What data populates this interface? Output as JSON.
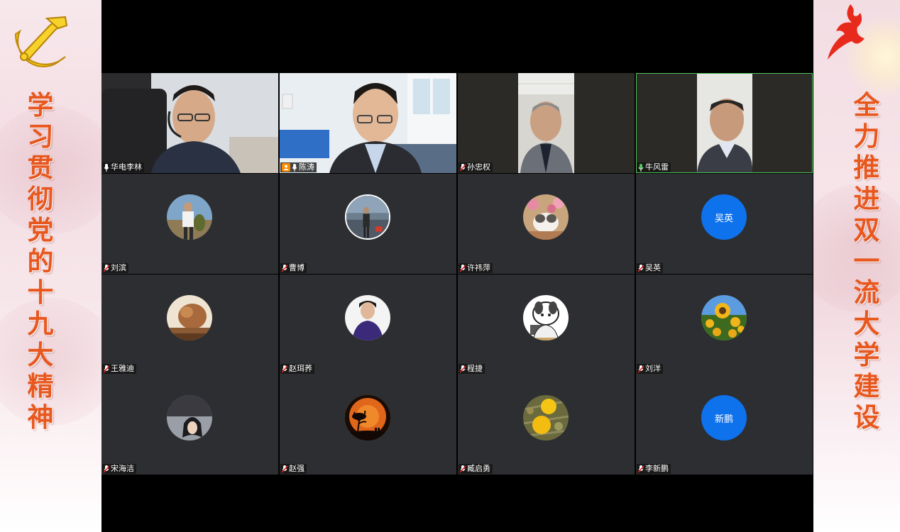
{
  "banners": {
    "left_slogan": [
      "学",
      "习",
      "贯",
      "彻",
      "党",
      "的",
      "十",
      "九",
      "大",
      "精",
      "神"
    ],
    "right_slogan": [
      "全",
      "力",
      "推",
      "进",
      "双",
      "一",
      "流",
      "大",
      "学",
      "建",
      "设"
    ],
    "left_emblem_icon": "hammer-sickle-icon",
    "right_emblem_icon": "red-eagle-icon"
  },
  "meeting": {
    "active_speaker_color": "#4fc45a",
    "avatar_color": "#0e72ed",
    "participants": [
      {
        "name": "华电李林",
        "mic": "on",
        "video": true
      },
      {
        "name": "陈涛",
        "mic": "on",
        "video": true,
        "host": true
      },
      {
        "name": "孙忠权",
        "mic": "muted",
        "video": true
      },
      {
        "name": "牛风雷",
        "mic": "speaking",
        "video": true,
        "active": true
      },
      {
        "name": "刘滨",
        "mic": "muted",
        "avatar": "photo-man-fishing"
      },
      {
        "name": "曹博",
        "mic": "muted",
        "avatar": "photo-man-lake"
      },
      {
        "name": "许祎萍",
        "mic": "muted",
        "avatar": "photo-cat"
      },
      {
        "name": "吴英",
        "mic": "muted",
        "avatar_text": "吴英"
      },
      {
        "name": "王雅迪",
        "mic": "muted",
        "avatar": "photo-bear-toy"
      },
      {
        "name": "赵珥荞",
        "mic": "muted",
        "avatar": "photo-man-purple"
      },
      {
        "name": "程捷",
        "mic": "muted",
        "avatar": "cartoon-dog"
      },
      {
        "name": "刘洋",
        "mic": "muted",
        "avatar": "photo-sunflower"
      },
      {
        "name": "宋海洁",
        "mic": "muted",
        "avatar": "photo-woman"
      },
      {
        "name": "赵强",
        "mic": "muted",
        "avatar": "photo-sunset-tree"
      },
      {
        "name": "臧启勇",
        "mic": "muted",
        "avatar": "photo-dandelion"
      },
      {
        "name": "李新鹏",
        "mic": "muted",
        "avatar_text": "新鹏"
      }
    ]
  }
}
